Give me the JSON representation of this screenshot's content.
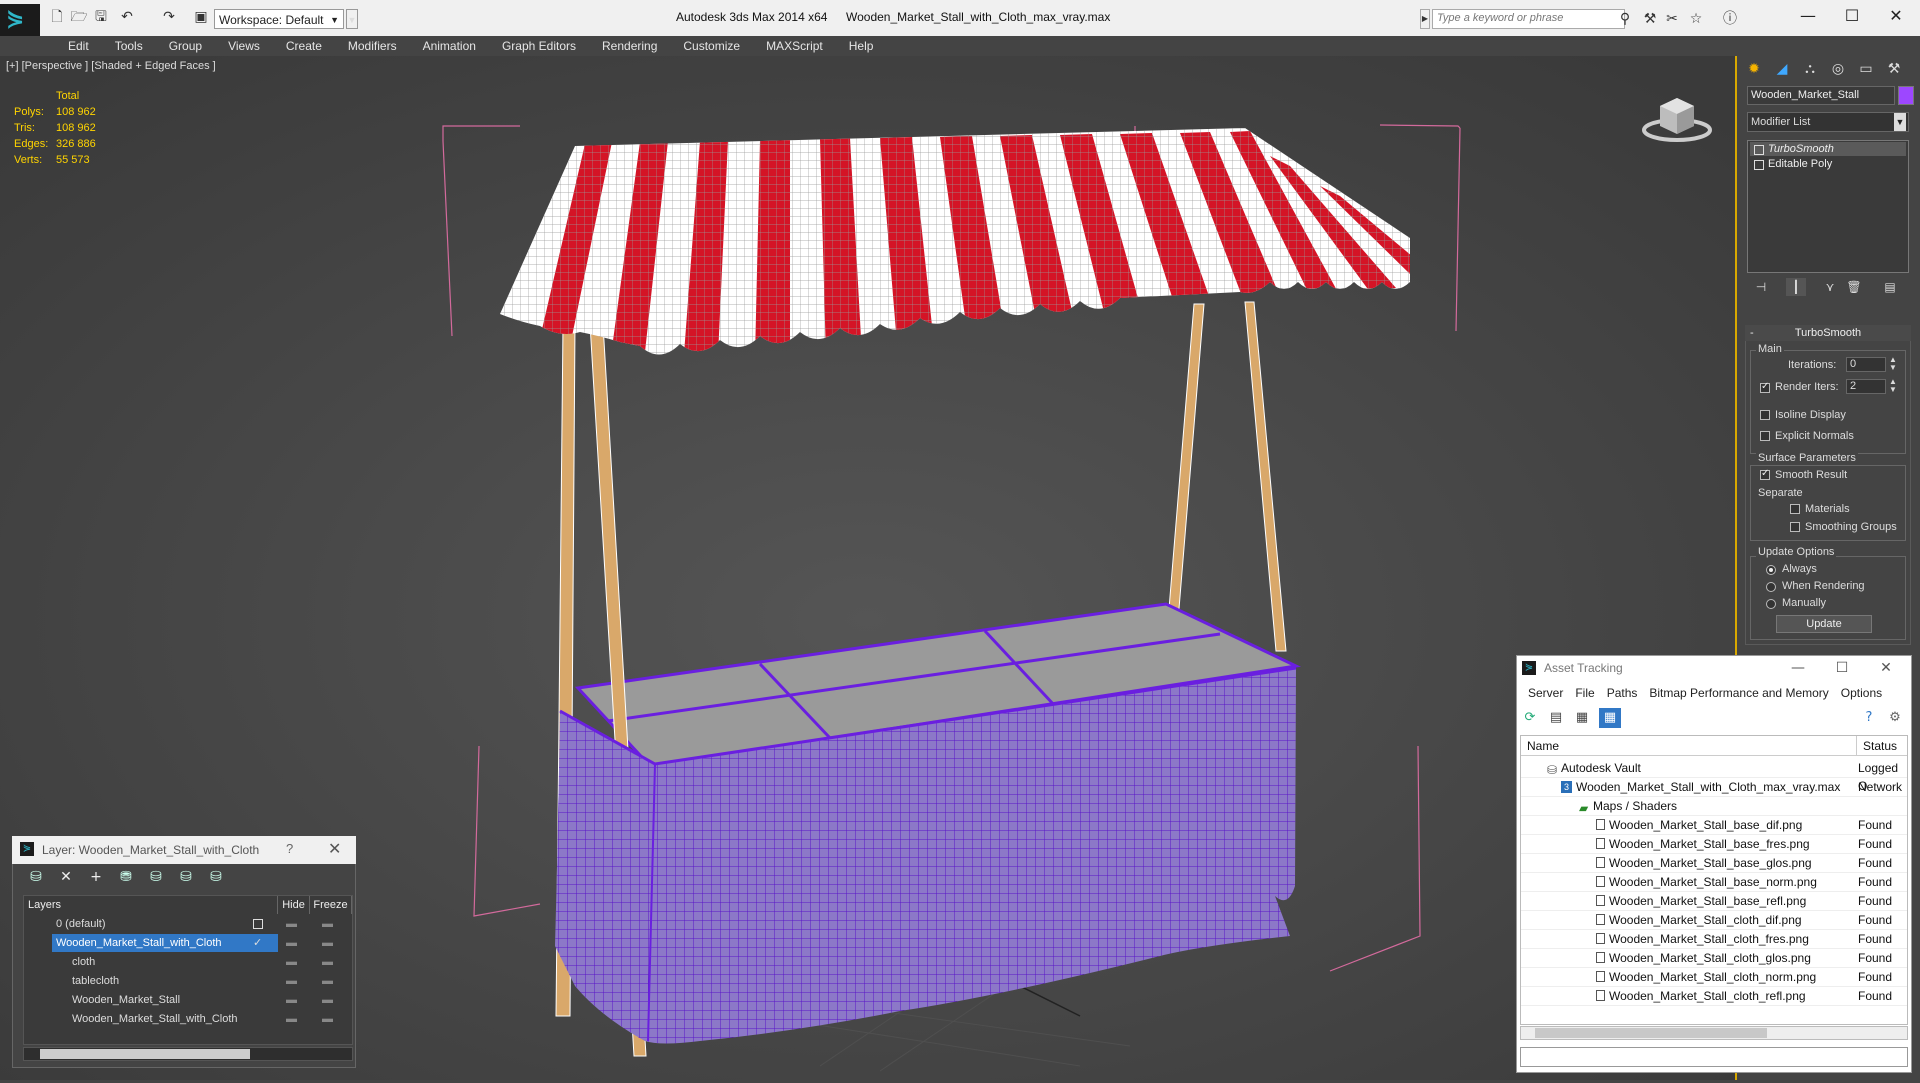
{
  "titlebar": {
    "workspace_label": "Workspace: Default",
    "app_title": "Autodesk 3ds Max  2014 x64",
    "file_title": "Wooden_Market_Stall_with_Cloth_max_vray.max",
    "search_placeholder": "Type a keyword or phrase"
  },
  "menu": [
    "Edit",
    "Tools",
    "Group",
    "Views",
    "Create",
    "Modifiers",
    "Animation",
    "Graph Editors",
    "Rendering",
    "Customize",
    "MAXScript",
    "Help"
  ],
  "viewport": {
    "label": "[+] [Perspective ] [Shaded + Edged Faces ]",
    "stats_header": "Total",
    "stats": [
      {
        "k": "Polys:",
        "v": "108 962"
      },
      {
        "k": "Tris:",
        "v": "108 962"
      },
      {
        "k": "Edges:",
        "v": "326 886"
      },
      {
        "k": "Verts:",
        "v": "55 573"
      }
    ]
  },
  "command_panel": {
    "object_name": "Wooden_Market_Stall",
    "object_color": "#9d47ff",
    "modifier_list_label": "Modifier List",
    "stack": [
      "TurboSmooth",
      "Editable Poly"
    ],
    "turbosmooth": {
      "title": "TurboSmooth",
      "main": "Main",
      "iterations_label": "Iterations:",
      "iterations_value": "0",
      "render_iters_label": "Render Iters:",
      "render_iters_value": "2",
      "isoline": "Isoline Display",
      "explicit_normals": "Explicit Normals",
      "surface_params": "Surface Parameters",
      "smooth_result": "Smooth Result",
      "separate": "Separate",
      "materials": "Materials",
      "smoothing_groups": "Smoothing Groups",
      "update_options": "Update Options",
      "always": "Always",
      "when_rendering": "When Rendering",
      "manually": "Manually",
      "update_button": "Update"
    }
  },
  "layer_dialog": {
    "title": "Layer: Wooden_Market_Stall_with_Cloth",
    "help": "?",
    "col_layers": "Layers",
    "col_hide": "Hide",
    "col_freeze": "Freeze",
    "rows": [
      {
        "name": "0 (default)"
      },
      {
        "name": "Wooden_Market_Stall_with_Cloth"
      },
      {
        "name": "cloth"
      },
      {
        "name": "tablecloth"
      },
      {
        "name": "Wooden_Market_Stall"
      },
      {
        "name": "Wooden_Market_Stall_with_Cloth"
      }
    ]
  },
  "asset_tracking": {
    "title": "Asset Tracking",
    "menu": [
      "Server",
      "File",
      "Paths",
      "Bitmap Performance and Memory",
      "Options"
    ],
    "col_name": "Name",
    "col_status": "Status",
    "rows": [
      {
        "name": "Autodesk Vault",
        "status": "Logged O"
      },
      {
        "name": "Wooden_Market_Stall_with_Cloth_max_vray.max",
        "status": "Network"
      },
      {
        "name": "Maps / Shaders",
        "status": ""
      },
      {
        "name": "Wooden_Market_Stall_base_dif.png",
        "status": "Found"
      },
      {
        "name": "Wooden_Market_Stall_base_fres.png",
        "status": "Found"
      },
      {
        "name": "Wooden_Market_Stall_base_glos.png",
        "status": "Found"
      },
      {
        "name": "Wooden_Market_Stall_base_norm.png",
        "status": "Found"
      },
      {
        "name": "Wooden_Market_Stall_base_refl.png",
        "status": "Found"
      },
      {
        "name": "Wooden_Market_Stall_cloth_dif.png",
        "status": "Found"
      },
      {
        "name": "Wooden_Market_Stall_cloth_fres.png",
        "status": "Found"
      },
      {
        "name": "Wooden_Market_Stall_cloth_glos.png",
        "status": "Found"
      },
      {
        "name": "Wooden_Market_Stall_cloth_norm.png",
        "status": "Found"
      },
      {
        "name": "Wooden_Market_Stall_cloth_refl.png",
        "status": "Found"
      }
    ]
  }
}
